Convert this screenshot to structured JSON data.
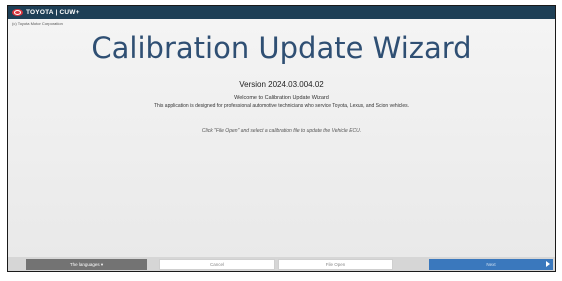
{
  "window": {
    "brand": "TOYOTA",
    "separator": "|",
    "app_name": "CUW+",
    "subtitle": "(c) Toyota Motor Corporation"
  },
  "main": {
    "heading": "Calibration Update Wizard",
    "version": "Version 2024.03.004.02",
    "welcome": "Welcome to Calibration Update Wizard",
    "description": "This application is designed for professional automotive technicians who service Toyota, Lexus, and Scion vehicles.",
    "hint": "Click \"File Open\" and select a calibration file to update the Vehicle ECU."
  },
  "footer": {
    "languages_label": "The languages ▾",
    "cancel_label": "Cancel",
    "file_open_label": "File Open",
    "next_label": "Next"
  },
  "status_text": "",
  "colors": {
    "titlebar": "#1e3f56",
    "heading": "#2f4f73",
    "next_button": "#3a78bd",
    "languages_button": "#737373"
  }
}
